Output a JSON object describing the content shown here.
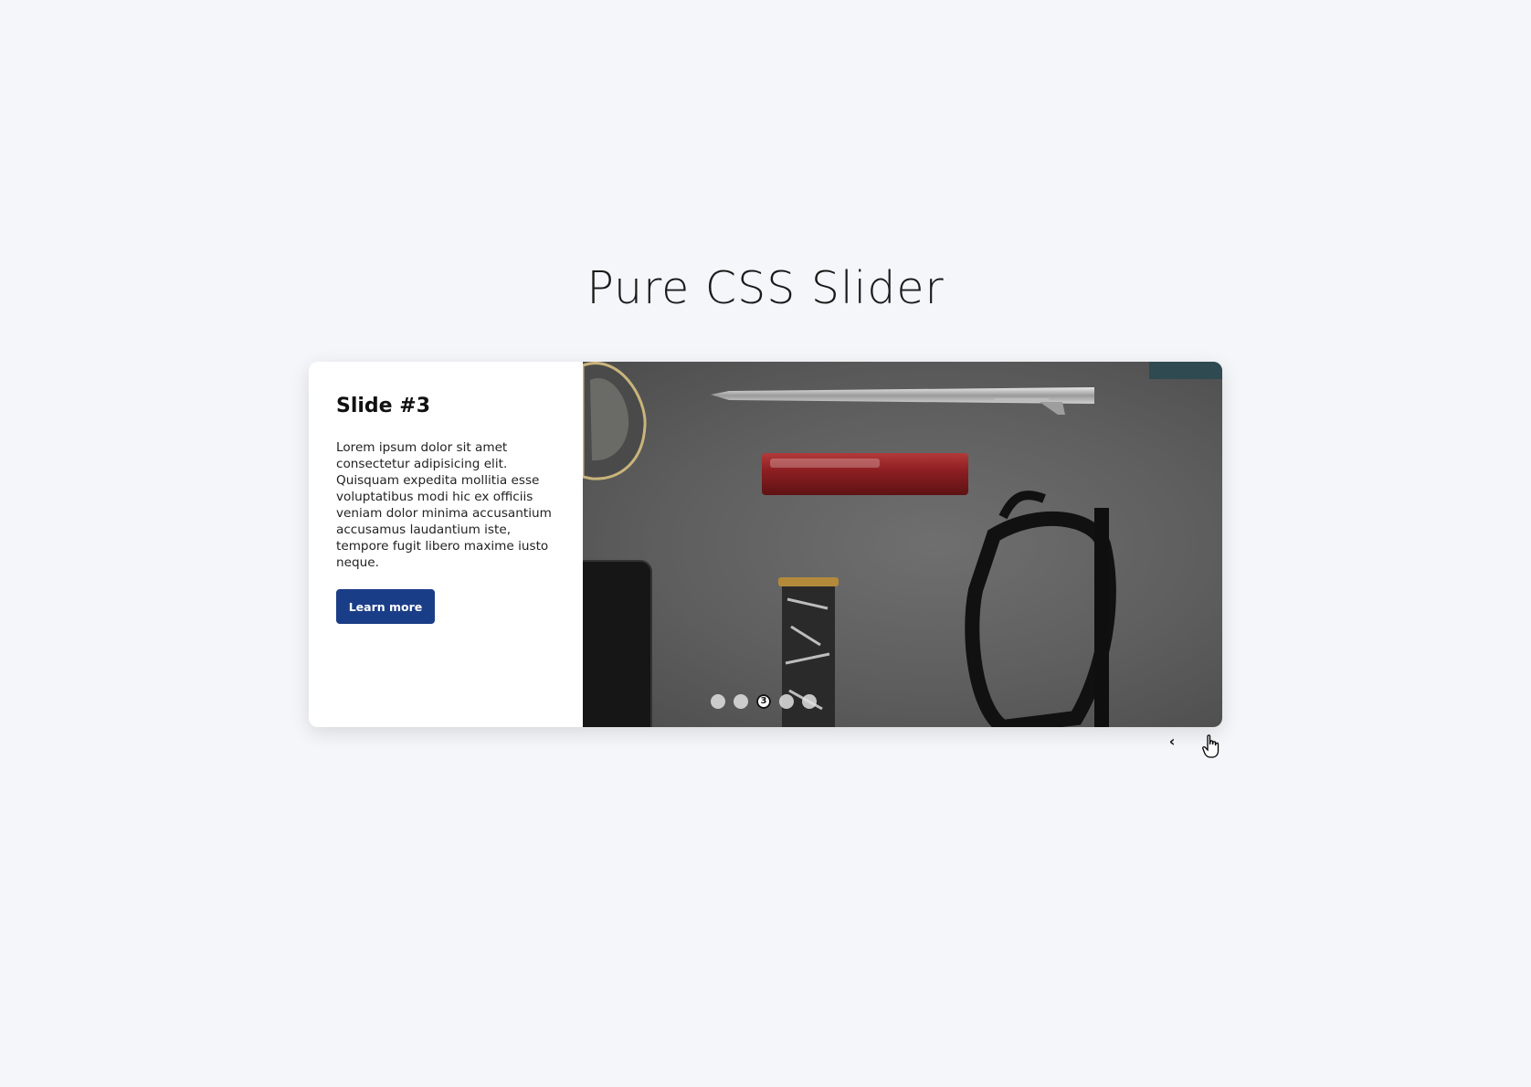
{
  "page": {
    "title": "Pure CSS Slider"
  },
  "slide": {
    "heading": "Slide #3",
    "body": "Lorem ipsum dolor sit amet consectetur adipisicing elit. Quisquam expedita mollitia esse voluptatibus modi hic ex officiis veniam dolor minima accusantium accusamus laudantium iste, tempore fugit libero maxime iusto neque.",
    "button_label": "Learn more",
    "image_icon": "desk-flatlay-photo"
  },
  "pagination": {
    "dots": [
      "",
      "",
      "3",
      "",
      ""
    ],
    "active_index": 2
  },
  "navigation": {
    "prev_icon": "chevron-left-icon",
    "next_icon": "chevron-right-icon",
    "prev_glyph": "‹",
    "next_glyph": "›"
  },
  "colors": {
    "background": "#f5f6fa",
    "button": "#1a3d87",
    "card": "#ffffff"
  }
}
